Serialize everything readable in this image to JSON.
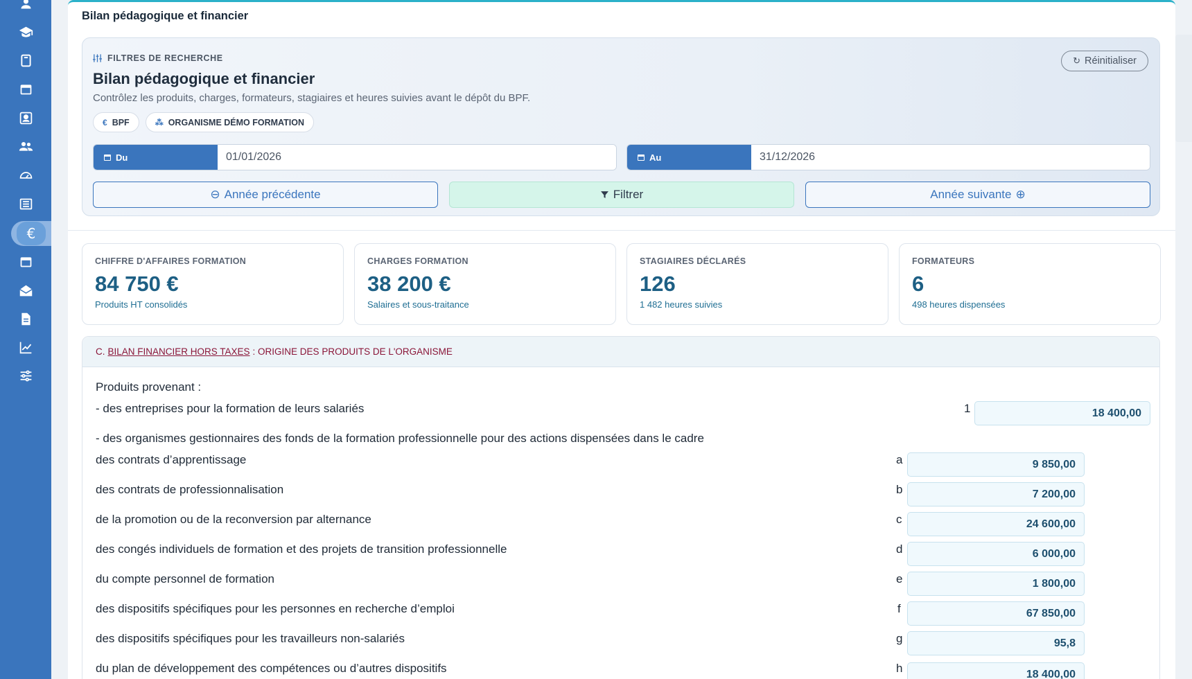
{
  "sidebar": {
    "icons": [
      {
        "name": "users-icon"
      },
      {
        "name": "graduation-cap-icon"
      },
      {
        "name": "book-icon"
      },
      {
        "name": "calendar-icon"
      },
      {
        "name": "id-card-icon"
      },
      {
        "name": "group-icon"
      },
      {
        "name": "dashboard-icon"
      },
      {
        "name": "newspaper-icon"
      },
      {
        "name": "euro-icon",
        "active": true,
        "glyph": "€"
      },
      {
        "name": "calendar-alt-icon"
      },
      {
        "name": "mail-open-icon"
      },
      {
        "name": "file-icon"
      },
      {
        "name": "chart-line-icon"
      },
      {
        "name": "sliders-icon"
      }
    ]
  },
  "page": {
    "title": "Bilan pédagogique et financier"
  },
  "filters": {
    "eyebrow": "FILTRES DE RECHERCHE",
    "title": "Bilan pédagogique et financier",
    "subtitle": "Contrôlez les produits, charges, formateurs, stagiaires et heures suivies avant le dépôt du BPF.",
    "reset_label": "Réinitialiser",
    "chips": [
      {
        "icon": "€",
        "label": "BPF"
      },
      {
        "icon": "⁂",
        "label": "ORGANISME DÉMO FORMATION"
      }
    ],
    "from_label": "Du",
    "from_value": "01/01/2026",
    "to_label": "Au",
    "to_value": "31/12/2026",
    "prev_label": "Année précédente",
    "filter_label": "Filtrer",
    "next_label": "Année suivante"
  },
  "kpis": [
    {
      "label": "CHIFFRE D'AFFAIRES FORMATION",
      "value": "84 750 €",
      "sub": "Produits HT consolidés"
    },
    {
      "label": "CHARGES FORMATION",
      "value": "38 200 €",
      "sub": "Salaires et sous-traitance"
    },
    {
      "label": "STAGIAIRES DÉCLARÉS",
      "value": "126",
      "sub": "1 482 heures suivies"
    },
    {
      "label": "FORMATEURS",
      "value": "6",
      "sub": "498 heures dispensées"
    }
  ],
  "section": {
    "lead": "C.",
    "underlined": "BILAN FINANCIER HORS TAXES",
    "rest": ": ORIGINE DES PRODUITS DE L'ORGANISME",
    "intro": "Produits provenant :",
    "line1": "- des entreprises pour la formation de leurs salariés",
    "line1_letter": "1",
    "line1_amount": "18 400,00",
    "opco_intro": "- des organismes gestionnaires des fonds de la formation professionnelle pour des actions dispensées dans le cadre",
    "rows": [
      {
        "text": "des contrats d’apprentissage",
        "letter": "a",
        "amount": "9 850,00"
      },
      {
        "text": "des contrats de professionnalisation",
        "letter": "b",
        "amount": "7 200,00"
      },
      {
        "text": "de la promotion ou de la reconversion par alternance",
        "letter": "c",
        "amount": "24 600,00"
      },
      {
        "text": "des congés individuels de formation et des projets de transition professionnelle",
        "letter": "d",
        "amount": "6 000,00"
      },
      {
        "text": "du compte personnel de formation",
        "letter": "e",
        "amount": "1 800,00"
      },
      {
        "text": "des dispositifs spécifiques pour les personnes en recherche d’emploi",
        "letter": "f",
        "amount": "67 850,00"
      },
      {
        "text": "des dispositifs spécifiques pour les travailleurs non-salariés",
        "letter": "g",
        "amount": "95,8"
      },
      {
        "text": "du plan de développement des compétences ou d’autres dispositifs",
        "letter": "h",
        "amount": "18 400,00"
      }
    ]
  },
  "colors": {
    "sidebar": "#3a75bd",
    "accent": "#1d5f84",
    "section_title": "#8a1538",
    "filter_btn": "#d5f5ea"
  }
}
